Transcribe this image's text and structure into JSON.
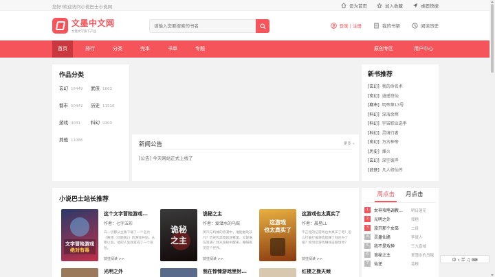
{
  "topbar": {
    "welcome": "您好!欢迎访问小说巴士小说网",
    "links": [
      {
        "label": "设为首页",
        "icon": "home-icon"
      },
      {
        "label": "加入收藏",
        "icon": "star-icon"
      },
      {
        "label": "桌面快捷",
        "icon": "send-icon"
      }
    ]
  },
  "header": {
    "logo_title": "文墨中文网",
    "logo_sub": "文墨文学旗下产品",
    "search_placeholder": "请输入您要搜索的书名",
    "login": "登录 | 注册",
    "bookshelf": "我的书架",
    "history": "阅读历史"
  },
  "nav": {
    "left": [
      "首页",
      "排行",
      "分类",
      "完本",
      "书单",
      "专题"
    ],
    "right": [
      "原创专区",
      "用户中心"
    ]
  },
  "categories": {
    "title": "作品分类",
    "items": [
      {
        "name": "玄幻",
        "count": "16449"
      },
      {
        "name": "武侠",
        "count": "1663"
      },
      {
        "name": "都市",
        "count": "50442"
      },
      {
        "name": "历史",
        "count": "11516"
      },
      {
        "name": "游戏",
        "count": "4041"
      },
      {
        "name": "科幻",
        "count": "9309"
      },
      {
        "name": "其他",
        "count": "11086"
      }
    ]
  },
  "news": {
    "title": "新闻公告",
    "more": "更多 »",
    "item": "[公告] 今天网站正式上线了"
  },
  "newbooks": {
    "title": "新书推荐",
    "items": [
      {
        "tag": "[玄幻]",
        "name": "我的命名术"
      },
      {
        "tag": "[玄幻]",
        "name": "逍遥符仙"
      },
      {
        "tag": "[都市]",
        "name": "明帝第13号"
      },
      {
        "tag": "[科幻]",
        "name": "深海余烬"
      },
      {
        "tag": "[科幻]",
        "name": "宇宙职业选手"
      },
      {
        "tag": "[科幻]",
        "name": "灵境行者"
      },
      {
        "tag": "[玄幻]",
        "name": "万古神帝"
      },
      {
        "tag": "[历史]",
        "name": "烽火"
      },
      {
        "tag": "[玄幻]",
        "name": "深空彼岸"
      },
      {
        "tag": "[武侠]",
        "name": "凡人修仙传"
      }
    ]
  },
  "recommend": {
    "title": "小说巴士站长推荐",
    "books": [
      {
        "title": "这个文字冒险游戏...",
        "author": "作者：七字五彩",
        "desc": "白一切都从主角下载了一个名为《赛博（问题版）》的游戏开始。从那以后，他的人生就变成了一个冒险。",
        "read": "前往阅读 >>",
        "cover_text": "文字冒险游戏 绝对有毒",
        "cover_colors": [
          "#2a3a6a",
          "#c0304a"
        ]
      },
      {
        "title": "诡秘之主",
        "author": "作者：爱潜水的乌贼",
        "desc": "蒸汽与机械的浪潮中，谁能触及非凡？历史和黑暗的迷雾里，又是谁在耳语？我从诡秘中醒来，睁眼看见这个世界。",
        "read": "前往阅读 >>",
        "cover_text": "诡秘之主",
        "cover_colors": [
          "#1a1a1a",
          "#7a2020"
        ]
      },
      {
        "title": "这游戏也太真实了",
        "author": "作者：晨星LL",
        "desc": "不正经的记游戏也太真实了吧！怎么打着打着游戏就赚了钱还升了级？如何玩游戏赚钱征服世界？",
        "read": "前往阅读 >>",
        "cover_text": "这游戏也太真实了",
        "cover_colors": [
          "#c88a20",
          "#8a3a10"
        ]
      }
    ],
    "row2": [
      "光明之外",
      "我在惊悚游戏里封...",
      "红楼之挽天倾"
    ]
  },
  "rank": {
    "tabs": [
      "周点击",
      "月点击"
    ],
    "items": [
      {
        "num": "1",
        "name": "女神攻略调教...",
        "author": "明日落花"
      },
      {
        "num": "2",
        "name": "光明之外",
        "author": "拜梧"
      },
      {
        "num": "3",
        "name": "旅开那个女巫",
        "author": "二目"
      },
      {
        "num": "4",
        "name": "灵蛊仙路",
        "author": "李鼠人"
      },
      {
        "num": "5",
        "name": "我不是戏神",
        "author": "三九音域"
      },
      {
        "num": "6",
        "name": "诡秘之主",
        "author": "爱潜水的乌贼"
      },
      {
        "num": "7",
        "name": "仙逆",
        "author": "耳根"
      }
    ]
  },
  "ime": "中 ⸰ 半 ♫ ⌨"
}
